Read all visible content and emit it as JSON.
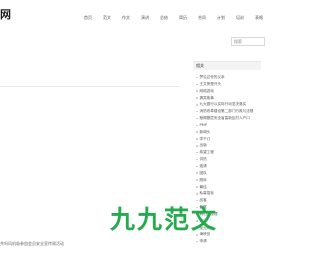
{
  "header": {
    "logo_fragment": "网",
    "nav": [
      "首页",
      "范文",
      "作文",
      "演讲",
      "总结",
      "简历",
      "合同",
      "计划",
      "培训",
      "表格"
    ],
    "search_placeholder": "搜索"
  },
  "sidebar": {
    "title": "相关",
    "items": [
      "梦见过世的父亲",
      "王文贺是开头",
      "网络游戏",
      "搞笑故事",
      "九大银行以实际行动坚决落实",
      "消防改革建设第二部门行政与法规",
      "粮棉基层安全省高新区村人户口",
      "PMP",
      "新闻头",
      "学干订",
      "出版",
      "希望工程",
      "供热",
      "邀请",
      "团队",
      "顺序",
      "最佳",
      "私募招标",
      "品客",
      "截尾",
      "韩山院经理",
      "万达",
      "龙元风力",
      "海峡岛",
      "申请"
    ]
  },
  "content": {
    "bottom_text": "共吗风机吸参加会员安全宣传周活动",
    "watermark": "九九范文"
  }
}
